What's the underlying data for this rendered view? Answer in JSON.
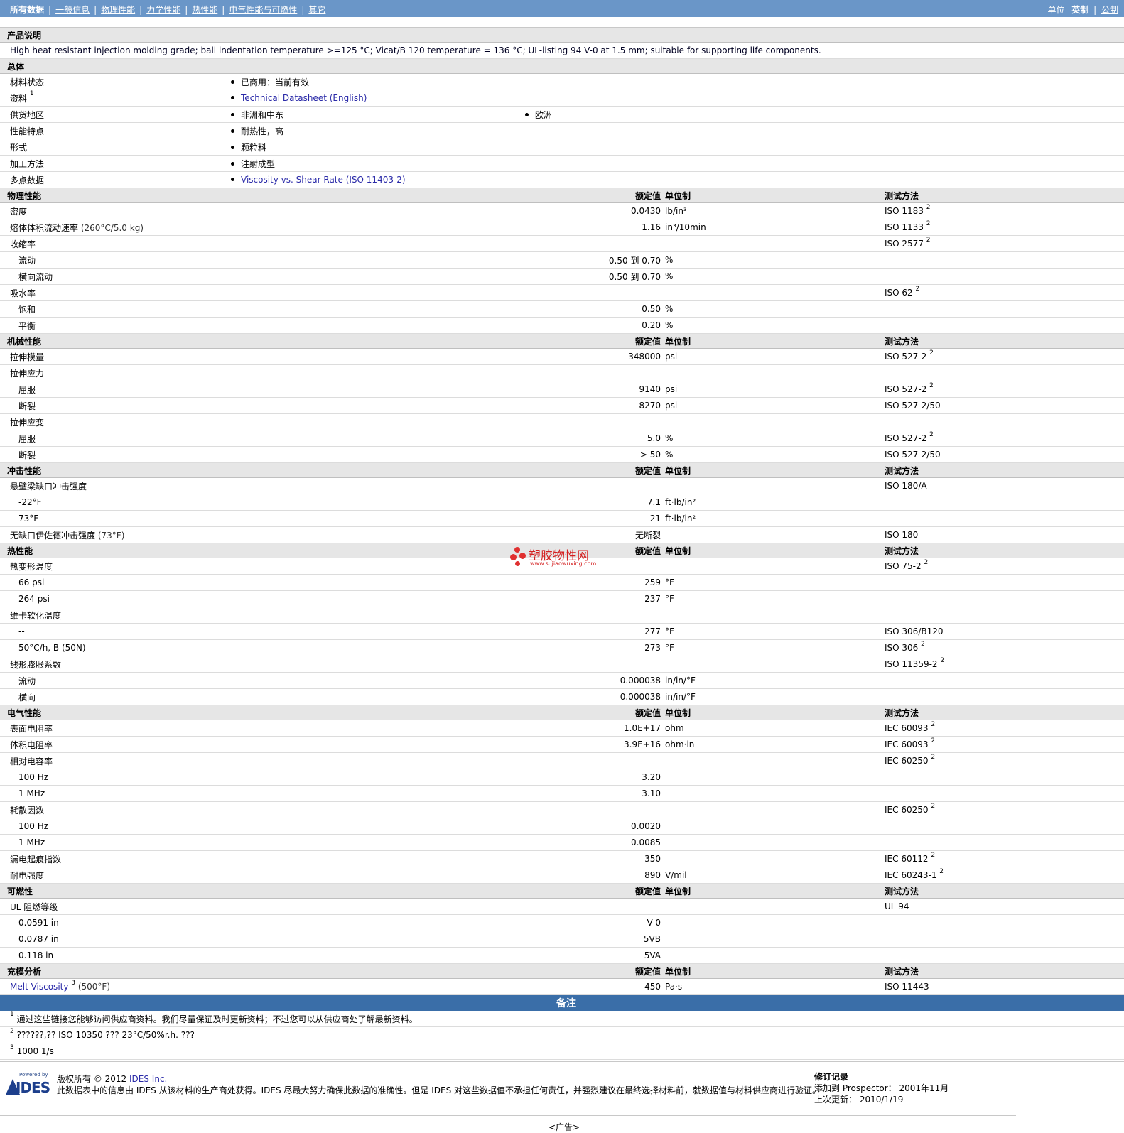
{
  "nav": {
    "tabs": [
      "所有数据",
      "一般信息",
      "物理性能",
      "力学性能",
      "热性能",
      "电气性能与可燃性",
      "其它"
    ],
    "units_label": "单位",
    "units_active": "英制",
    "units_other": "公制"
  },
  "desc": {
    "title": "产品说明",
    "text": "High heat resistant injection molding grade; ball indentation temperature >=125 °C; Vicat/B 120 temperature = 136 °C; UL-listing 94 V-0 at 1.5 mm; suitable for supporting life components."
  },
  "general": {
    "title": "总体",
    "rows": [
      {
        "label": "材料状态",
        "values": [
          "已商用：当前有效"
        ]
      },
      {
        "label": "资料",
        "sup": "1",
        "values": [
          "Technical Datasheet (English)"
        ],
        "link": true
      },
      {
        "label": "供货地区",
        "values": [
          "非洲和中东",
          "欧洲"
        ]
      },
      {
        "label": "性能特点",
        "values": [
          "耐热性，高"
        ]
      },
      {
        "label": "形式",
        "values": [
          "颗粒料"
        ]
      },
      {
        "label": "加工方法",
        "values": [
          "注射成型"
        ]
      },
      {
        "label": "多点数据",
        "values": [
          "Viscosity vs. Shear Rate (ISO 11403-2)"
        ],
        "blue": true
      }
    ]
  },
  "col_headers": {
    "value": "额定值",
    "unit": "单位制",
    "method": "测试方法"
  },
  "sections": [
    {
      "title": "物理性能",
      "rows": [
        {
          "label": "密度",
          "value": "0.0430",
          "unit": "lb/in³",
          "method": "ISO 1183",
          "sup": "2"
        },
        {
          "label": "熔体体积流动速率",
          "cond": "(260°C/5.0 kg)",
          "value": "1.16",
          "unit": "in³/10min",
          "method": "ISO 1133",
          "sup": "2"
        },
        {
          "label": "收缩率",
          "method": "ISO 2577",
          "sup": "2"
        },
        {
          "label": "流动",
          "sub": true,
          "value": "0.50 到  0.70",
          "unit": "%"
        },
        {
          "label": "横向流动",
          "sub": true,
          "value": "0.50 到  0.70",
          "unit": "%"
        },
        {
          "label": "吸水率",
          "method": "ISO 62",
          "sup": "2"
        },
        {
          "label": "饱和",
          "sub": true,
          "value": "0.50",
          "unit": "%"
        },
        {
          "label": "平衡",
          "sub": true,
          "value": "0.20",
          "unit": "%"
        }
      ]
    },
    {
      "title": "机械性能",
      "rows": [
        {
          "label": "拉伸模量",
          "value": "348000",
          "unit": "psi",
          "method": "ISO 527-2",
          "sup": "2"
        },
        {
          "label": "拉伸应力"
        },
        {
          "label": "屈服",
          "sub": true,
          "value": "9140",
          "unit": "psi",
          "method": "ISO 527-2",
          "sup": "2"
        },
        {
          "label": "断裂",
          "sub": true,
          "value": "8270",
          "unit": "psi",
          "method": "ISO 527-2/50"
        },
        {
          "label": "拉伸应变"
        },
        {
          "label": "屈服",
          "sub": true,
          "value": "5.0",
          "unit": "%",
          "method": "ISO 527-2",
          "sup": "2"
        },
        {
          "label": "断裂",
          "sub": true,
          "value": "> 50",
          "unit": "%",
          "method": "ISO 527-2/50"
        }
      ]
    },
    {
      "title": "冲击性能",
      "rows": [
        {
          "label": "悬壁梁缺口冲击强度",
          "method": "ISO 180/A"
        },
        {
          "label": "-22°F",
          "sub": true,
          "value": "7.1",
          "unit": "ft·lb/in²"
        },
        {
          "label": "73°F",
          "sub": true,
          "value": "21",
          "unit": "ft·lb/in²"
        },
        {
          "label": "无缺口伊佐德冲击强度",
          "cond": "(73°F)",
          "value": "无断裂",
          "method": "ISO 180"
        }
      ]
    },
    {
      "title": "热性能",
      "rows": [
        {
          "label": "热变形温度",
          "method": "ISO 75-2",
          "sup": "2"
        },
        {
          "label": "66 psi",
          "sub": true,
          "value": "259",
          "unit": "°F"
        },
        {
          "label": "264 psi",
          "sub": true,
          "value": "237",
          "unit": "°F"
        },
        {
          "label": "维卡软化温度"
        },
        {
          "label": "--",
          "sub": true,
          "value": "277",
          "unit": "°F",
          "method": "ISO 306/B120"
        },
        {
          "label": "50°C/h, B (50N)",
          "sub": true,
          "value": "273",
          "unit": "°F",
          "method": "ISO 306",
          "sup": "2"
        },
        {
          "label": "线形膨胀系数",
          "method": "ISO 11359-2",
          "sup": "2"
        },
        {
          "label": "流动",
          "sub": true,
          "value": "0.000038",
          "unit": "in/in/°F"
        },
        {
          "label": "横向",
          "sub": true,
          "value": "0.000038",
          "unit": "in/in/°F"
        }
      ]
    },
    {
      "title": "电气性能",
      "rows": [
        {
          "label": "表面电阻率",
          "value": "1.0E+17",
          "unit": "ohm",
          "method": "IEC 60093",
          "sup": "2"
        },
        {
          "label": "体积电阻率",
          "value": "3.9E+16",
          "unit": "ohm·in",
          "method": "IEC 60093",
          "sup": "2"
        },
        {
          "label": "相对电容率",
          "method": "IEC 60250",
          "sup": "2"
        },
        {
          "label": "100 Hz",
          "sub": true,
          "value": "3.20"
        },
        {
          "label": "1 MHz",
          "sub": true,
          "value": "3.10"
        },
        {
          "label": "耗散因数",
          "method": "IEC 60250",
          "sup": "2"
        },
        {
          "label": "100 Hz",
          "sub": true,
          "value": "0.0020"
        },
        {
          "label": "1 MHz",
          "sub": true,
          "value": "0.0085"
        },
        {
          "label": "漏电起痕指数",
          "value": "350",
          "method": "IEC 60112",
          "sup": "2"
        },
        {
          "label": "耐电强度",
          "value": "890",
          "unit": "V/mil",
          "method": "IEC 60243-1",
          "sup": "2"
        }
      ]
    },
    {
      "title": "可燃性",
      "rows": [
        {
          "label": "UL 阻燃等级",
          "method": "UL 94"
        },
        {
          "label": "0.0591 in",
          "sub": true,
          "value": "V-0"
        },
        {
          "label": "0.0787 in",
          "sub": true,
          "value": "5VB"
        },
        {
          "label": "0.118 in",
          "sub": true,
          "value": "5VA"
        }
      ]
    },
    {
      "title": "充模分析",
      "rows": [
        {
          "label": "Melt Viscosity",
          "lsup": "3",
          "cond": "(500°F)",
          "value": "450",
          "unit": "Pa·s",
          "method": "ISO 11443"
        }
      ]
    }
  ],
  "notes": {
    "title": "备注",
    "items": [
      {
        "num": "1",
        "text": "通过这些链接您能够访问供应商资料。我们尽量保证及时更新资料；不过您可以从供应商处了解最新资料。"
      },
      {
        "num": "2",
        "text": "??????,?? ISO 10350 ??? 23°C/50%r.h. ???"
      },
      {
        "num": "3",
        "text": "1000 1/s"
      }
    ]
  },
  "watermark": {
    "title": "塑胶物性网",
    "url": "www.sujiaowuxing.com"
  },
  "footer": {
    "logo_powered": "Powered by",
    "logo_text": "IDES",
    "copyright_prefix": "版权所有  © 2012",
    "copyright_link": "IDES Inc.",
    "disclaimer": "此数据表中的信息由  IDES 从该材料的生产商处获得。IDES 尽最大努力确保此数据的准确性。但是  IDES 对这些数据值不承担任何责任，并强烈建议在最终选择材料前，就数据值与材料供应商进行验证。",
    "rev_title": "修订记录",
    "rev_added": "添加到  Prospector：  2001年11月",
    "rev_updated": "上次更新：  2010/1/19",
    "ad": "<广告>"
  }
}
